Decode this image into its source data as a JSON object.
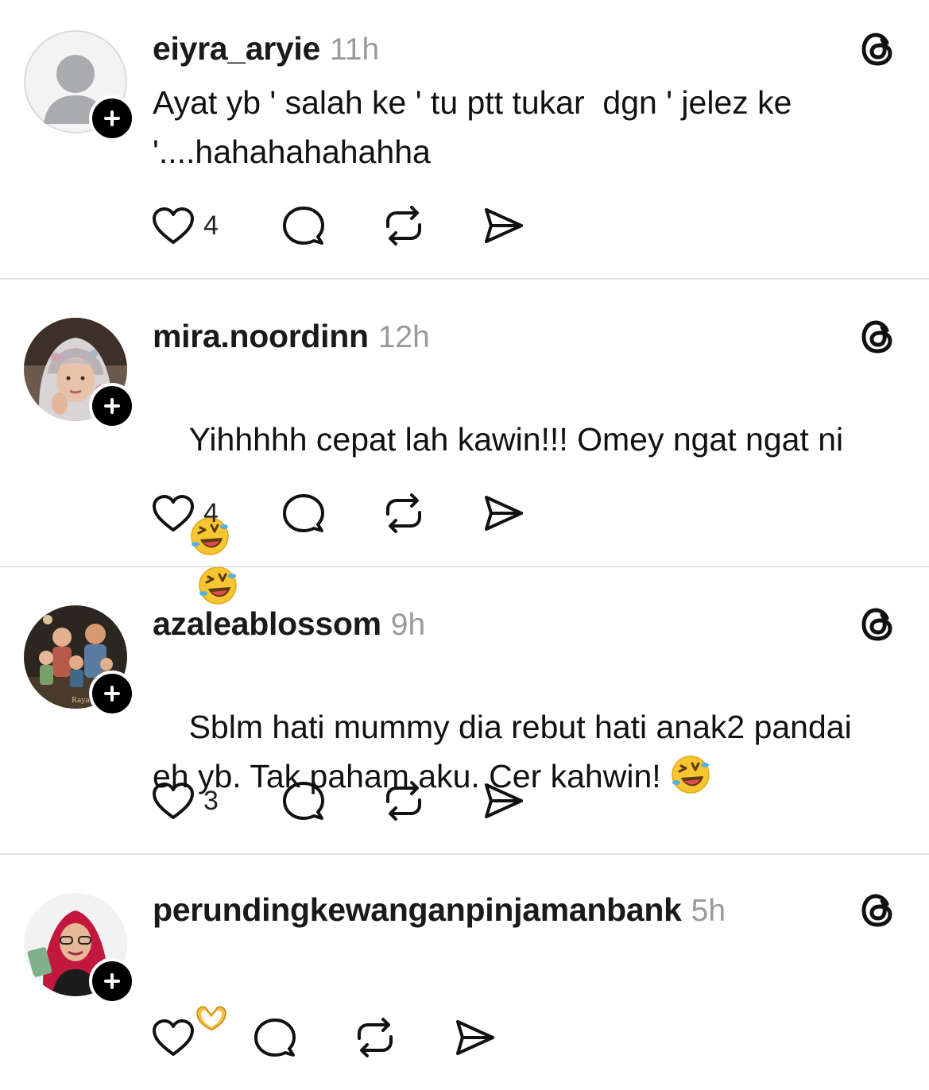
{
  "posts": [
    {
      "username": "eiyra_aryie",
      "time": "11h",
      "text": "Ayat yb ' salah ke ' tu ptt tukar  dgn ' jelez ke\n'....hahahahahahha",
      "emojis": [],
      "likes": "4",
      "avatar": "default-person-icon"
    },
    {
      "username": "mira.noordinn",
      "time": "12h",
      "text": "Yihhhhh cepat lah kawin!!! Omey ngat ngat ni",
      "emojis": [
        "rolling-on-floor-laughing",
        "rolling-on-floor-laughing"
      ],
      "likes": "4",
      "avatar": "hijab-woman-photo"
    },
    {
      "username": "azaleablossom",
      "time": "9h",
      "text": "Sblm hati mummy dia rebut hati anak2 pandai\neh yb. Tak paham aku. Cer kahwin! ",
      "emojis": [
        "rolling-on-floor-laughing"
      ],
      "likes": "3",
      "avatar": "family-cartoon-photo"
    },
    {
      "username": "perundingkewanganpinjamanbank",
      "time": "5h",
      "text": "",
      "emojis": [
        "heart-hands"
      ],
      "likes": "",
      "avatar": "woman-red-hijab-photo"
    }
  ],
  "icons": {
    "like": "heart-outline-icon",
    "reply": "speech-bubble-icon",
    "repost": "repost-arrows-icon",
    "share": "send-paper-plane-icon",
    "brand": "threads-logo-icon"
  },
  "colors": {
    "text": "#111111",
    "muted": "#9a9a9a",
    "divider": "#e3e3e3",
    "follow": "#000000"
  }
}
